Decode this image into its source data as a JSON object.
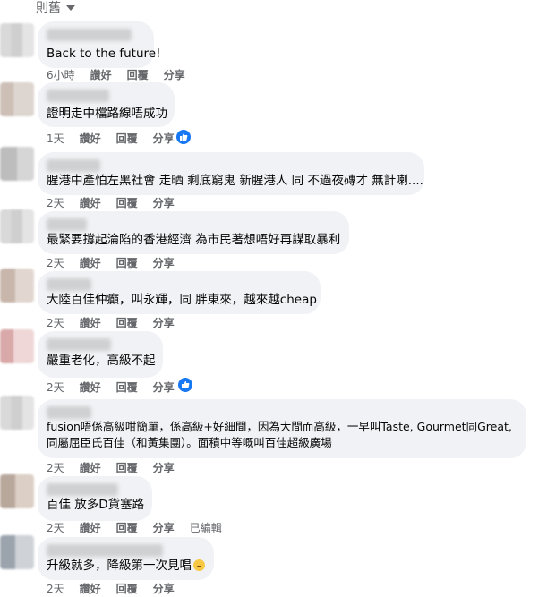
{
  "sort": {
    "label": "則舊"
  },
  "actions": {
    "like": "讚好",
    "reply": "回覆",
    "share": "分享",
    "edited": "已編輯"
  },
  "comments": [
    {
      "text": "Back to the future!",
      "time": "6小時"
    },
    {
      "text": "證明走中檔路線唔成功",
      "time": "1天",
      "reaction": "like"
    },
    {
      "text": "腥港中產怕左黑社會 走晒 剩底窮鬼 新腥港人 同 不過夜磚才 無計喇....",
      "time": "2天"
    },
    {
      "text": "最緊要撐起淪陷的香港經濟 為市民著想唔好再謀取暴利",
      "time": "2天"
    },
    {
      "text": "大陸百佳仲癲，叫永輝，同 胖東來，越來越cheap",
      "time": "2天"
    },
    {
      "text": "嚴重老化，高級不起",
      "time": "2天",
      "reaction": "like"
    },
    {
      "text": "fusion唔係高級咁簡單，係高級+好細間，因為大間而高級，一早叫Taste, Gourmet同Great,同屬屈臣氏百佳（和黃集團）。面積中等嘅叫百佳超級廣場",
      "time": "2天"
    },
    {
      "text": "百佳 放多D貨塞路",
      "time": "2天",
      "edited": true
    },
    {
      "text": "升級就多，降級第一次見唱",
      "time": "2天",
      "emoji": "grimace"
    }
  ]
}
